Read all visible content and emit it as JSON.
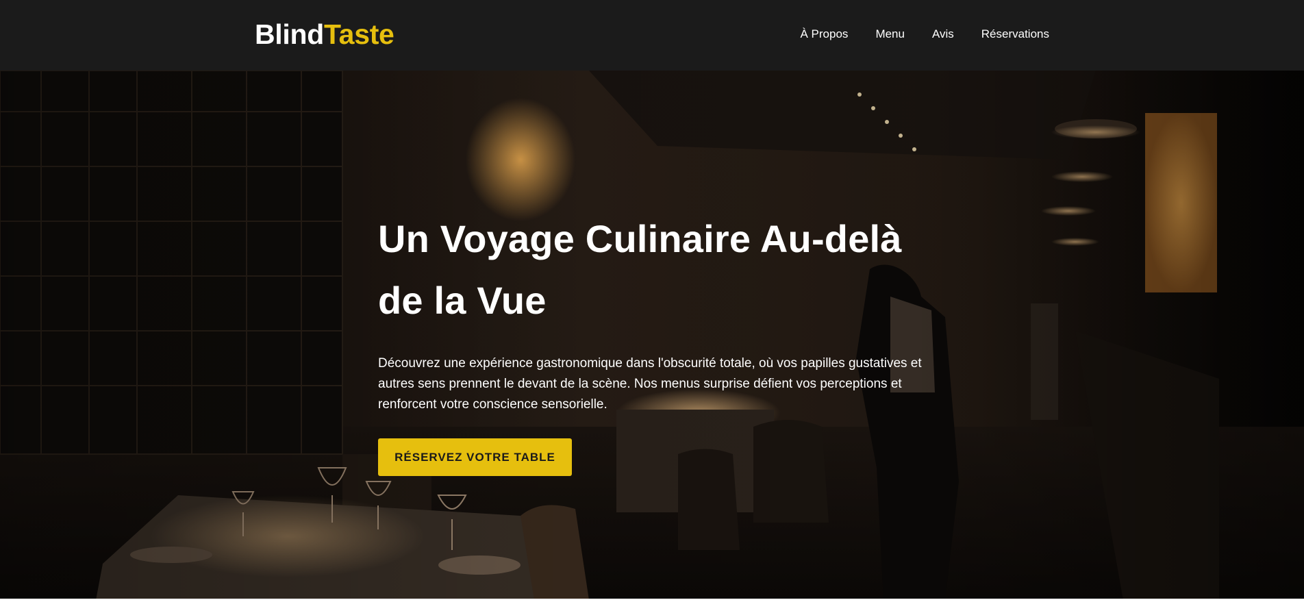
{
  "brand": {
    "name_part1": "Blind",
    "name_part2": "Taste",
    "accent_color": "#e6bf0e"
  },
  "nav": {
    "items": [
      {
        "label": "À Propos"
      },
      {
        "label": "Menu"
      },
      {
        "label": "Avis"
      },
      {
        "label": "Réservations"
      }
    ]
  },
  "hero": {
    "background_image": "dark-restaurant-dining-room-photo",
    "title": "Un Voyage Culinaire Au-delà de la Vue",
    "description": "Découvrez une expérience gastronomique dans l'obscurité totale, où vos papilles gustatives et autres sens prennent le devant de la scène. Nos menus surprise défient vos perceptions et renforcent votre conscience sensorielle.",
    "cta_label": "RÉSERVEZ VOTRE TABLE"
  },
  "colors": {
    "header_bg": "#1b1b1b",
    "text": "#ffffff",
    "cta_bg": "#e6bf0e"
  }
}
